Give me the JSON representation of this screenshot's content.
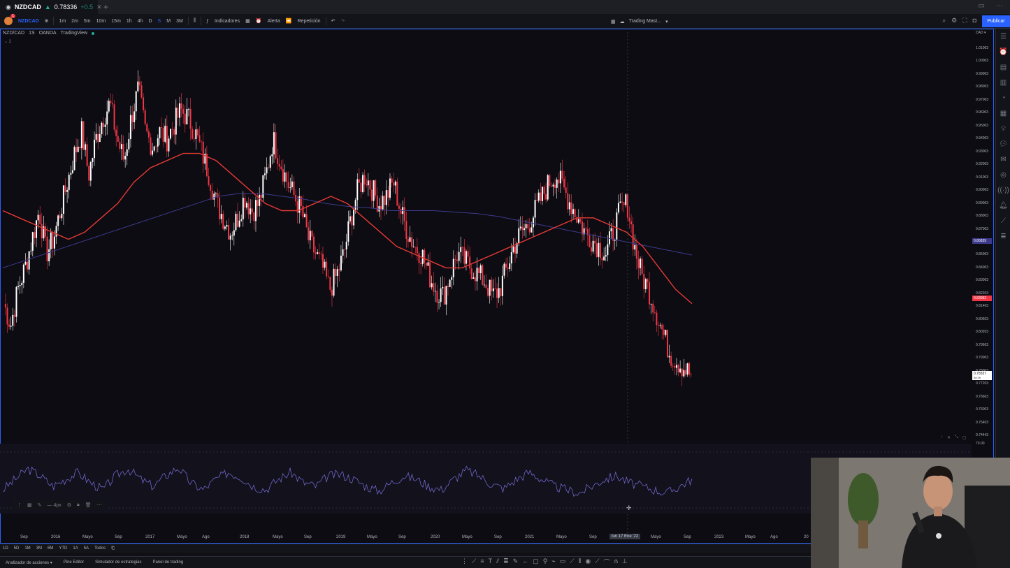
{
  "tab": {
    "symbol": "NZDCAD",
    "price": "0.78336",
    "change": "+0.5"
  },
  "toolbar": {
    "symbol": "NZDCAD",
    "intervals": [
      "1m",
      "2m",
      "5m",
      "10m",
      "15m",
      "1h",
      "4h",
      "D",
      "S",
      "M",
      "3M"
    ],
    "indicators_label": "Indicadores",
    "alert_label": "Alerta",
    "replay_label": "Repetición",
    "layout_name": "Trading Mast...",
    "publish_label": "Publicar"
  },
  "legend": {
    "pair": "NZD/CAD",
    "interval": "1S",
    "broker": "OANDA",
    "platform": "TradingView",
    "sub": "2"
  },
  "price_axis": {
    "currency": "CAD",
    "labels": [
      "1.01003",
      "1.00003",
      "0.99003",
      "0.98003",
      "0.97003",
      "0.96003",
      "0.95003",
      "0.94003",
      "0.93003",
      "0.92003",
      "0.91003",
      "0.90003",
      "0.89003",
      "0.88003",
      "0.87003",
      "0.86003",
      "0.85003",
      "0.84003",
      "0.83003",
      "0.82203",
      "0.81403",
      "0.80603",
      "0.80203",
      "0.79603",
      "0.79003",
      "0.78003",
      "0.77203",
      "0.76603",
      "0.76003",
      "0.75403",
      "0.74443"
    ],
    "tag_ma200": "0.86839",
    "tag_ma50": "0.83092",
    "tag_last": "0.78337",
    "tag_countdown": "3d 2h",
    "rsi_label": "70.00"
  },
  "date_axis": {
    "labels": [
      "Sep",
      "2016",
      "Mayo",
      "Sep",
      "2017",
      "Mayo",
      "Ago",
      "2018",
      "Mayo",
      "Sep",
      "2019",
      "Mayo",
      "Sep",
      "2020",
      "Mayo",
      "Sep",
      "2021",
      "Mayo",
      "Sep",
      "lun 17 Ene '22",
      "Mayo",
      "Sep",
      "2023",
      "Mayo",
      "Ago",
      "20"
    ]
  },
  "ranges": [
    "1D",
    "5D",
    "1M",
    "3M",
    "6M",
    "YTD",
    "1A",
    "5A",
    "Todos"
  ],
  "panels": [
    "Analizador de acciones",
    "Pine Editor",
    "Simulador de estrategias",
    "Panel de trading"
  ],
  "drawing_toolbar": {
    "width_label": "4px"
  },
  "colors": {
    "up": "#ffffff",
    "down": "#f23645",
    "ma50": "#e53935",
    "ma200": "#3d3a8c",
    "rsi": "#6f66c9",
    "accent": "#2962ff"
  },
  "chart_data": {
    "type": "candlestick",
    "title": "",
    "xlabel": "",
    "ylabel": "",
    "ylim": [
      0.744,
      1.015
    ],
    "x_start": "2015-07",
    "x_end": "2022-09",
    "close_weekly_approx": [
      0.835,
      0.82,
      0.845,
      0.86,
      0.88,
      0.9,
      0.87,
      0.88,
      0.9,
      0.92,
      0.94,
      0.955,
      0.925,
      0.95,
      0.965,
      0.975,
      0.95,
      0.935,
      0.965,
      0.985,
      0.955,
      0.945,
      0.955,
      0.95,
      0.96,
      0.97,
      0.965,
      0.955,
      0.94,
      0.925,
      0.905,
      0.895,
      0.885,
      0.895,
      0.91,
      0.9,
      0.905,
      0.925,
      0.95,
      0.935,
      0.92,
      0.91,
      0.9,
      0.88,
      0.87,
      0.86,
      0.845,
      0.855,
      0.87,
      0.895,
      0.915,
      0.925,
      0.915,
      0.905,
      0.91,
      0.92,
      0.9,
      0.885,
      0.875,
      0.87,
      0.855,
      0.845,
      0.84,
      0.855,
      0.87,
      0.865,
      0.86,
      0.855,
      0.85,
      0.84,
      0.845,
      0.86,
      0.875,
      0.885,
      0.89,
      0.9,
      0.91,
      0.92,
      0.925,
      0.915,
      0.905,
      0.895,
      0.885,
      0.88,
      0.875,
      0.87,
      0.885,
      0.9,
      0.905,
      0.875,
      0.855,
      0.845,
      0.83,
      0.815,
      0.8,
      0.795,
      0.79,
      0.785
    ],
    "ma50_approx": [
      0.9,
      0.895,
      0.89,
      0.885,
      0.88,
      0.885,
      0.895,
      0.905,
      0.92,
      0.93,
      0.935,
      0.94,
      0.94,
      0.935,
      0.925,
      0.915,
      0.905,
      0.9,
      0.9,
      0.905,
      0.91,
      0.905,
      0.895,
      0.885,
      0.875,
      0.87,
      0.865,
      0.86,
      0.86,
      0.865,
      0.87,
      0.875,
      0.88,
      0.885,
      0.89,
      0.895,
      0.895,
      0.89,
      0.885,
      0.875,
      0.86,
      0.845,
      0.835
    ],
    "ma200_approx": [
      0.86,
      0.865,
      0.87,
      0.875,
      0.88,
      0.885,
      0.89,
      0.895,
      0.9,
      0.905,
      0.91,
      0.912,
      0.912,
      0.91,
      0.908,
      0.905,
      0.903,
      0.902,
      0.9,
      0.9,
      0.9,
      0.899,
      0.898,
      0.896,
      0.893,
      0.89,
      0.887,
      0.884,
      0.881,
      0.878,
      0.875,
      0.872,
      0.869
    ],
    "rsi_approx": [
      40,
      55,
      70,
      60,
      45,
      55,
      65,
      50,
      40,
      60,
      70,
      55,
      45,
      60,
      72,
      50,
      40,
      55,
      65,
      58,
      45,
      40,
      55,
      65,
      50,
      45,
      60,
      62,
      55,
      45,
      38,
      50,
      60,
      55,
      45,
      40,
      55,
      68,
      60,
      48,
      42,
      55,
      65,
      55,
      45,
      40,
      35,
      45,
      55,
      60,
      50,
      45,
      40,
      35,
      45,
      55
    ]
  }
}
